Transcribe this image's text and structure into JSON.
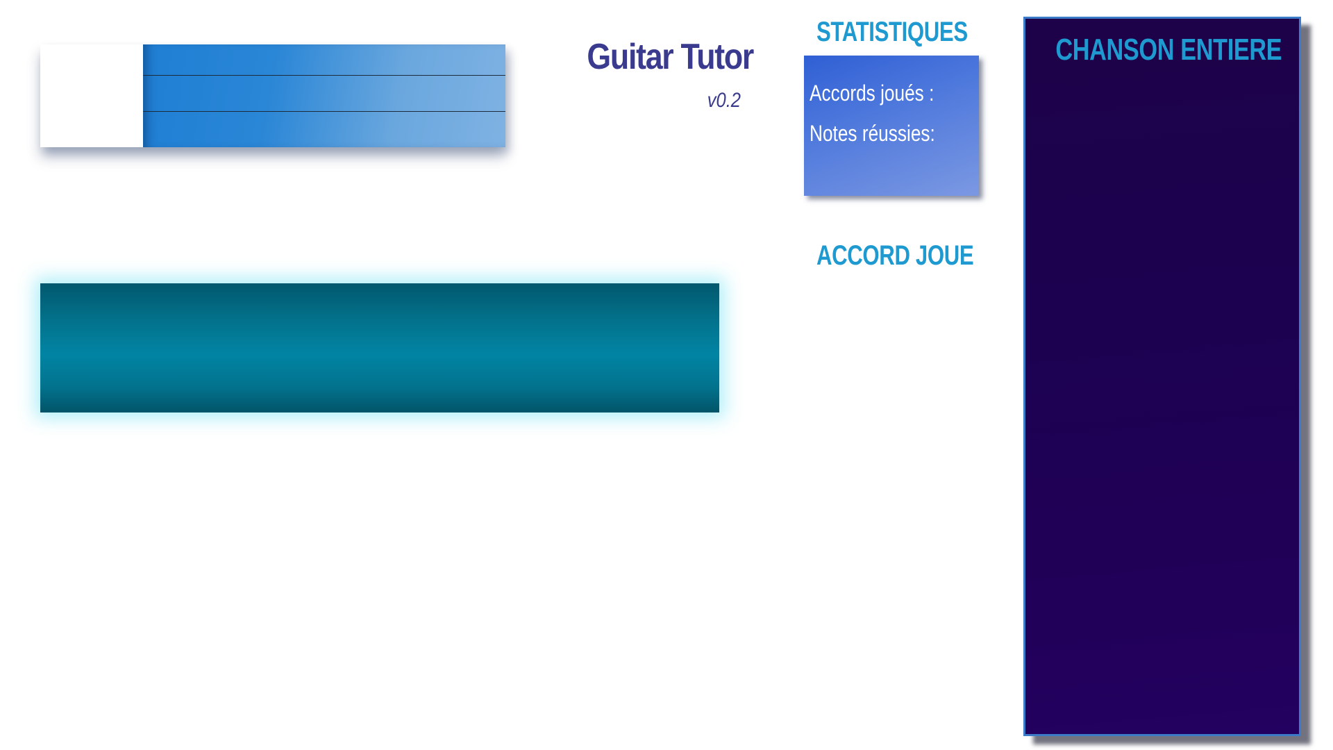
{
  "app": {
    "title": "Guitar Tutor",
    "version": "v0.2"
  },
  "statistics": {
    "heading": "STATISTIQUES",
    "chords_played_label": "Accords joués :",
    "notes_succeeded_label": "Notes réussies:"
  },
  "played_chord": {
    "heading": "ACCORD JOUE"
  },
  "whole_song": {
    "heading": "CHANSON ENTIERE"
  },
  "colors": {
    "title": "#3a3a8e",
    "heading": "#1e9ad0",
    "stats_panel": "#4d78dc",
    "teal_bar": "#0184a3",
    "song_panel": "#1d0249",
    "song_panel_border": "#3d7bc8"
  }
}
